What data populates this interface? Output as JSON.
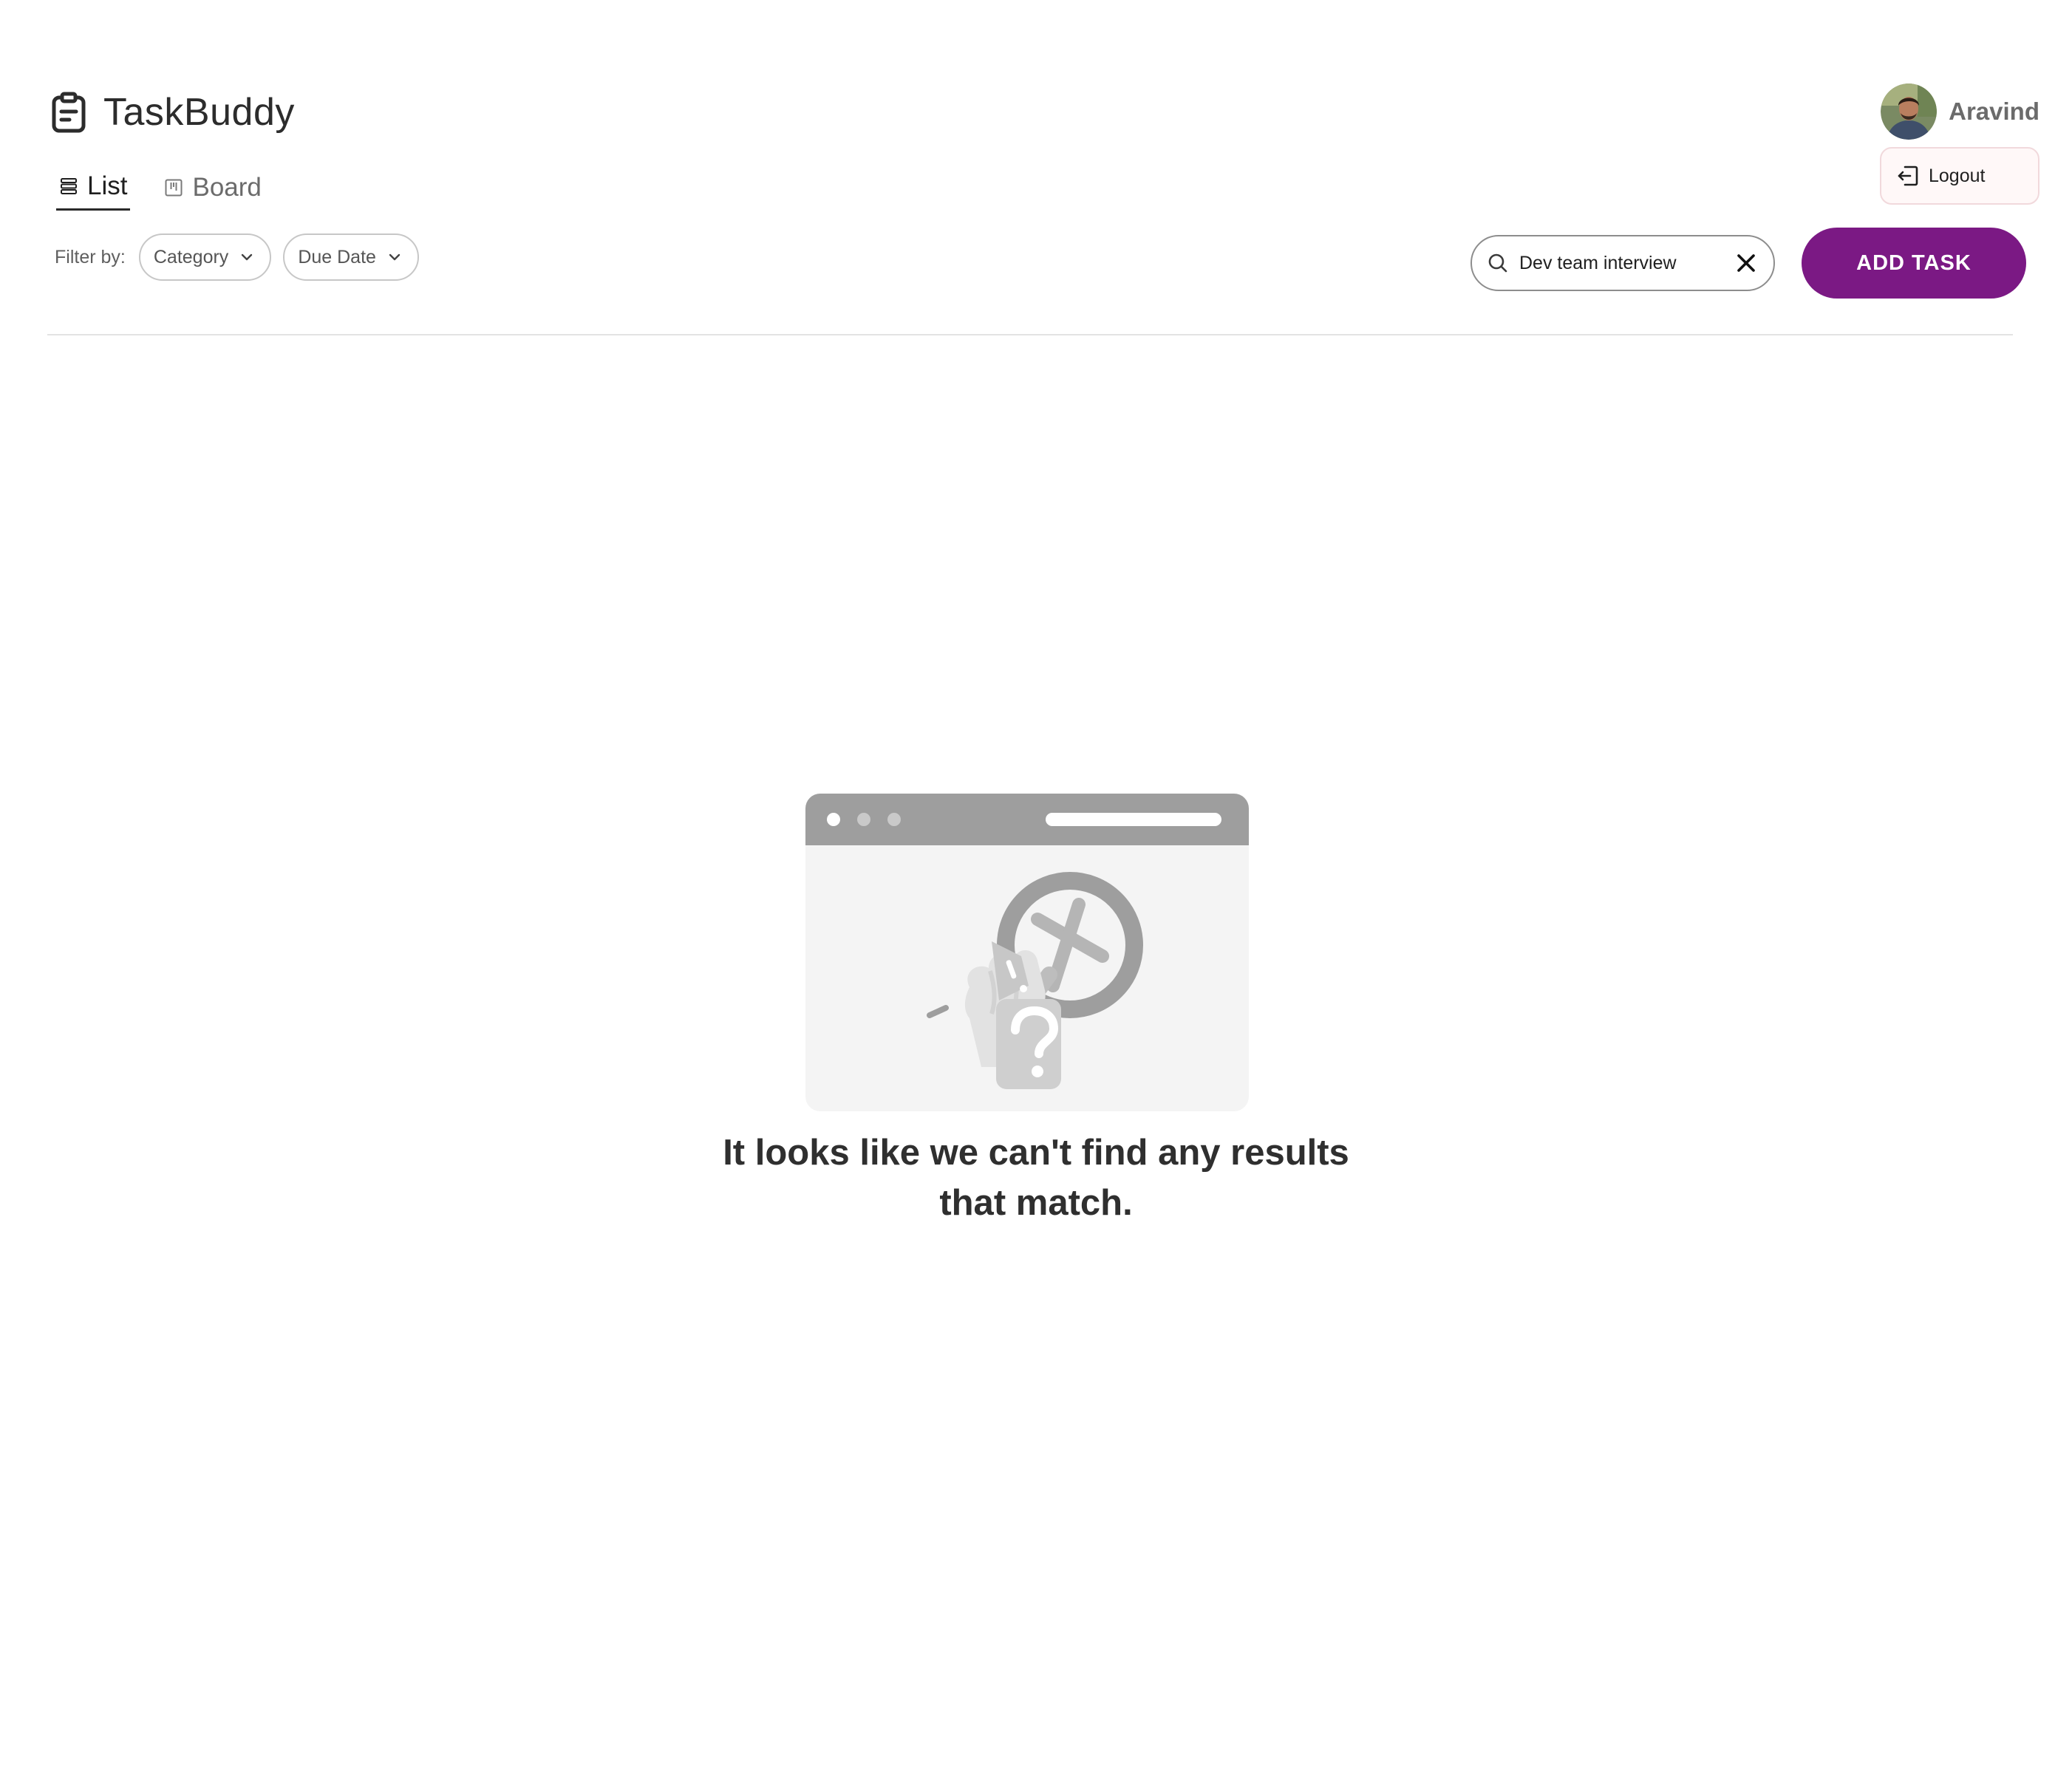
{
  "app": {
    "title": "TaskBuddy",
    "icon": "clipboard-icon"
  },
  "user": {
    "name": "Aravind",
    "logout_label": "Logout"
  },
  "tabs": [
    {
      "label": "List",
      "icon": "list-icon",
      "active": true
    },
    {
      "label": "Board",
      "icon": "board-icon",
      "active": false
    }
  ],
  "filters": {
    "label": "Filter by:",
    "category": "Category",
    "due_date": "Due Date"
  },
  "search": {
    "value": "Dev team interview"
  },
  "actions": {
    "add_task_label": "ADD TASK"
  },
  "empty_state": {
    "line1": "It looks like we can't find any results",
    "line2": "that match."
  },
  "colors": {
    "accent": "#7b1984",
    "illustration_gray": "#9e9e9e",
    "illustration_light": "#f3f3f3"
  }
}
